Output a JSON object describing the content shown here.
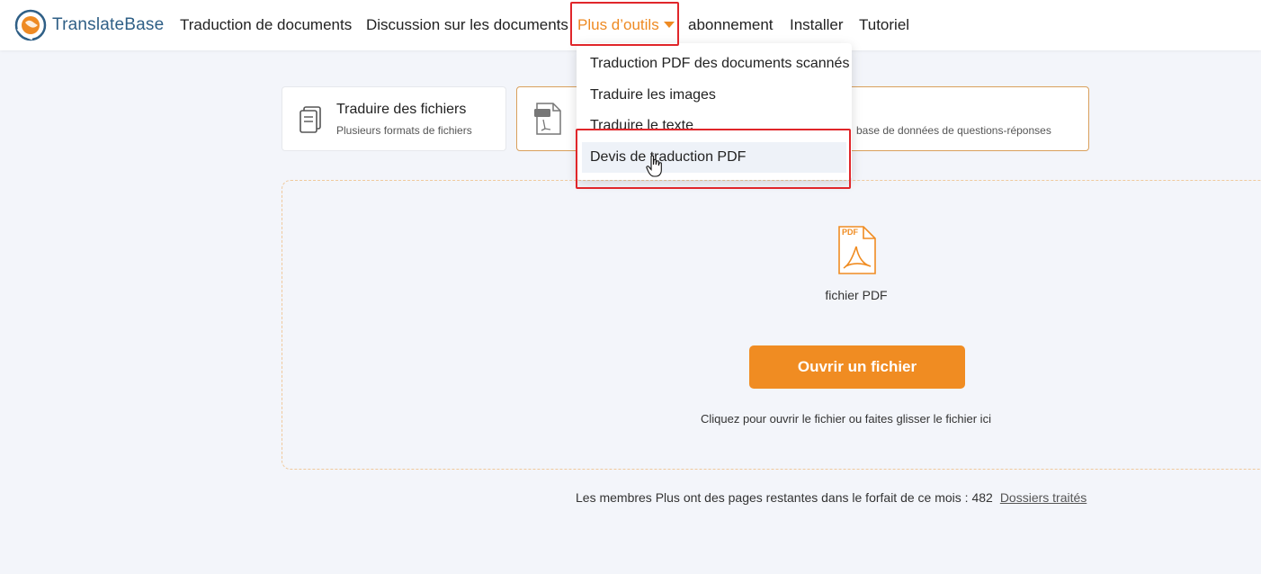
{
  "header": {
    "brand": "TranslateBase",
    "nav": [
      {
        "label": "Traduction de documents"
      },
      {
        "label": "Discussion sur les documents"
      },
      {
        "label": "Plus d’outils"
      },
      {
        "label": "abonnement"
      },
      {
        "label": "Installer"
      },
      {
        "label": "Tutoriel"
      }
    ]
  },
  "dropdown": {
    "items": [
      {
        "label": "Traduction PDF des documents scannés"
      },
      {
        "label": "Traduire les images"
      },
      {
        "label": "Traduire le texte"
      },
      {
        "label": "Devis de traduction PDF"
      }
    ]
  },
  "modes": {
    "files": {
      "title": "Traduire des fichiers",
      "subtitle": "Plusieurs formats de fichiers"
    },
    "pdf_qa": {
      "subtitle_partial": "base de données de questions-réponses"
    }
  },
  "upload": {
    "file_type_label": "fichier PDF",
    "pdf_badge": "PDF",
    "button_label": "Ouvrir un fichier",
    "hint": "Cliquez pour ouvrir le fichier ou faites glisser le fichier ici"
  },
  "footer": {
    "remaining_text": "Les membres Plus ont des pages restantes dans le forfait de ce mois : 482",
    "link": "Dossiers traités"
  },
  "colors": {
    "accent": "#f08c22",
    "brand_text": "#2f5f86",
    "highlight": "#e0262a"
  }
}
